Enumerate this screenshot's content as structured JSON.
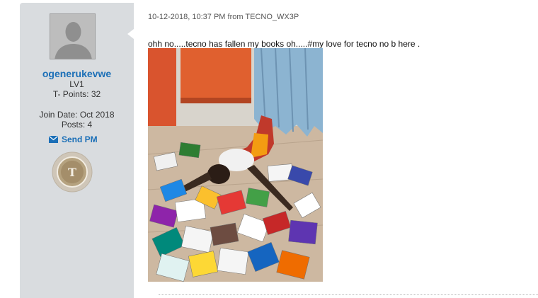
{
  "user": {
    "username": "ogenerukevwe",
    "level": "LV1",
    "points": "T- Points: 32",
    "join_date": "Join Date: Oct 2018",
    "posts": "Posts: 4",
    "send_pm": "Send PM",
    "badge_letter": "T"
  },
  "post": {
    "meta": "10-12-2018, 10:37 PM from ",
    "device": "TECNO_WX3P",
    "text": "ohh no.....tecno has fallen my books oh.....#my love for tecno no b here ."
  },
  "colors": {
    "sidebar": "#d9dcdf",
    "link": "#1b6fb7"
  }
}
